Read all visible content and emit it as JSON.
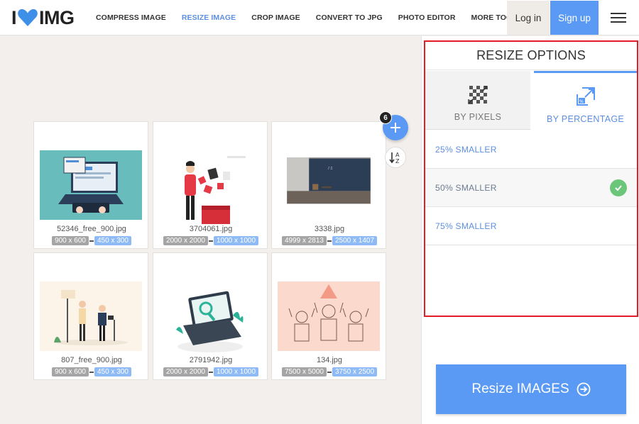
{
  "app": {
    "logo_left": "I",
    "logo_right": "IMG"
  },
  "nav": {
    "items": [
      {
        "label": "COMPRESS IMAGE"
      },
      {
        "label": "RESIZE IMAGE"
      },
      {
        "label": "CROP IMAGE"
      },
      {
        "label": "CONVERT TO JPG"
      },
      {
        "label": "PHOTO EDITOR"
      },
      {
        "label": "MORE TOOLS"
      }
    ],
    "active": "RESIZE IMAGE"
  },
  "auth": {
    "login": "Log in",
    "signup": "Sign up"
  },
  "files": {
    "count": "6",
    "items": [
      {
        "name": "52346_free_900.jpg",
        "original": "900 x 600",
        "resized": "450 x 300"
      },
      {
        "name": "3704061.jpg",
        "original": "2000 x 2000",
        "resized": "1000 x 1000"
      },
      {
        "name": "3338.jpg",
        "original": "4999 x 2813",
        "resized": "2500 x 1407"
      },
      {
        "name": "807_free_900.jpg",
        "original": "900 x 600",
        "resized": "450 x 300"
      },
      {
        "name": "2791942.jpg",
        "original": "2000 x 2000",
        "resized": "1000 x 1000"
      },
      {
        "name": "134.jpg",
        "original": "7500 x 5000",
        "resized": "3750 x 2500"
      }
    ]
  },
  "sidebar": {
    "title": "RESIZE OPTIONS",
    "tabs": [
      {
        "label": "BY PIXELS",
        "icon": "pixels-icon"
      },
      {
        "label": "BY PERCENTAGE",
        "icon": "percentage-icon"
      }
    ],
    "active_tab": "BY PERCENTAGE",
    "options": [
      {
        "label": "25% SMALLER"
      },
      {
        "label": "50% SMALLER"
      },
      {
        "label": "75% SMALLER"
      }
    ],
    "selected_option": "50% SMALLER"
  },
  "action": {
    "label": "Resize IMAGES"
  },
  "colors": {
    "accent": "#5a9af5",
    "highlight_border": "#e11d25",
    "logo_heart": "#3d8fe8",
    "check": "#6cc67a"
  }
}
